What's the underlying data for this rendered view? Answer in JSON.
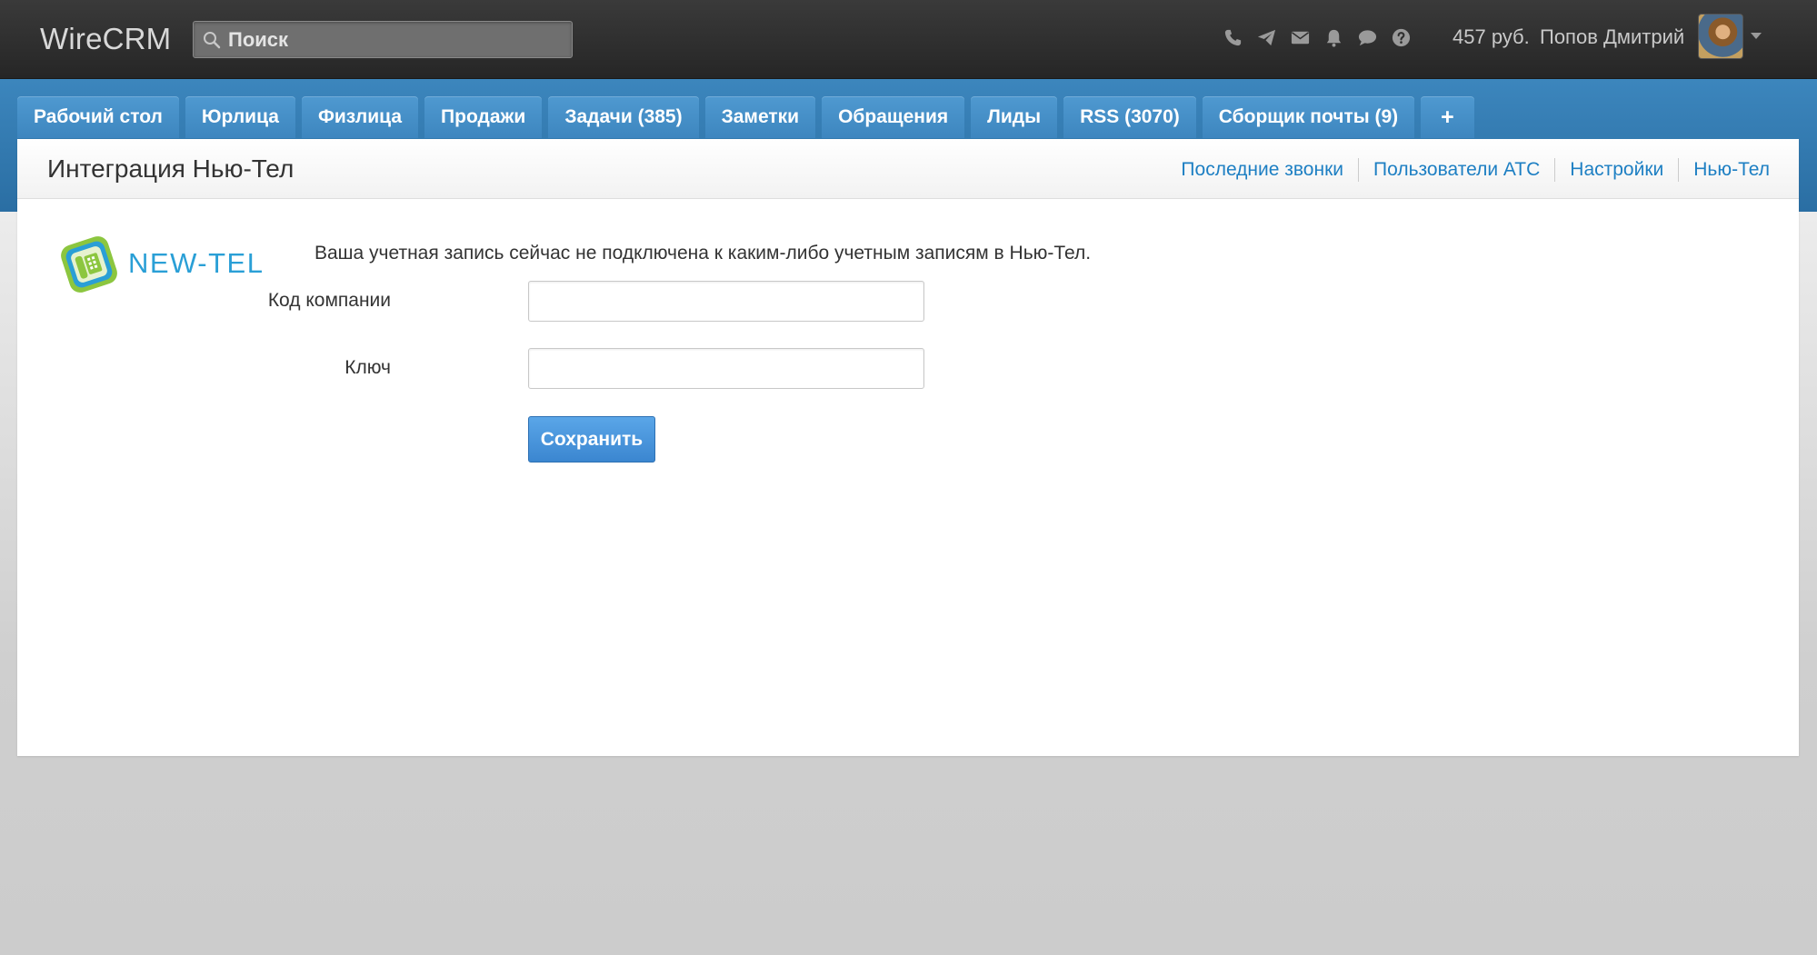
{
  "header": {
    "brand": "WireCRM",
    "search": {
      "placeholder": "Поиск",
      "value": ""
    },
    "icons": [
      "phone-icon",
      "send-icon",
      "mail-icon",
      "bell-icon",
      "chat-icon",
      "help-icon"
    ],
    "balance": "457 руб.",
    "username": "Попов Дмитрий"
  },
  "nav": {
    "tabs": [
      {
        "label": "Рабочий стол"
      },
      {
        "label": "Юрлица"
      },
      {
        "label": "Физлица"
      },
      {
        "label": "Продажи"
      },
      {
        "label": "Задачи (385)"
      },
      {
        "label": "Заметки"
      },
      {
        "label": "Обращения"
      },
      {
        "label": "Лиды"
      },
      {
        "label": "RSS (3070)"
      },
      {
        "label": "Сборщик почты (9)"
      },
      {
        "label": "+"
      }
    ]
  },
  "page": {
    "title": "Интеграция Нью-Тел",
    "sublinks": [
      {
        "label": "Последние звонки"
      },
      {
        "label": "Пользователи АТС"
      },
      {
        "label": "Настройки"
      },
      {
        "label": "Нью-Тел"
      }
    ],
    "logo_text": "NEW-TEL",
    "notice": "Ваша учетная запись сейчас не подключена к каким-либо учетным записям в Нью-Тел.",
    "form": {
      "company_code_label": "Код компании",
      "company_code_value": "",
      "key_label": "Ключ",
      "key_value": "",
      "save_label": "Сохранить"
    }
  },
  "colors": {
    "topbar": "#2f2f2f",
    "nav_band": "#3179b0",
    "tab": "#4690c8",
    "link": "#1d7fc3",
    "button": "#4a96dc",
    "logo_green": "#8cc63f",
    "logo_blue": "#2a9fd6"
  }
}
